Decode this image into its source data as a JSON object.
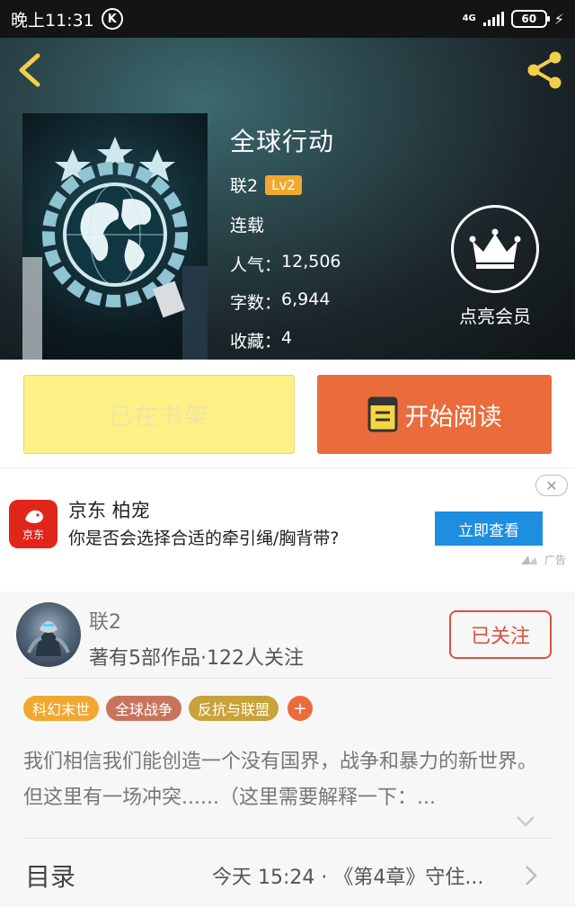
{
  "status_bar": {
    "time": "晚上11:31",
    "carrier_icon_letter": "K",
    "network": "4G",
    "battery": "60"
  },
  "book": {
    "title": "全球行动",
    "author": "联2",
    "author_level": "Lv2",
    "status": "连载",
    "popularity_label": "人气：",
    "popularity": "12,506",
    "words_label": "字数：",
    "words": "6,944",
    "favorites_label": "收藏：",
    "favorites": "4"
  },
  "vip": {
    "label": "点亮会员"
  },
  "actions": {
    "shelf_label": "已在书架",
    "read_label": "开始阅读"
  },
  "ad": {
    "brand": "京东",
    "title": "京东 柏宠",
    "description": "你是否会选择合适的牵引绳/胸背带?",
    "cta": "立即查看",
    "tag": "广告",
    "close": "✕"
  },
  "author_card": {
    "name": "联2",
    "meta": "著有5部作品·122人关注",
    "follow_label": "已关注",
    "tags": [
      {
        "label": "科幻末世",
        "color": "#f0a830"
      },
      {
        "label": "全球战争",
        "color": "#c8735c"
      },
      {
        "label": "反抗与联盟",
        "color": "#c9a23a"
      }
    ],
    "tag_add": "+",
    "intro": "我们相信我们能创造一个没有国界，战争和暴力的新世界。但这里有一场冲突......（这里需要解释一下：..."
  },
  "toc": {
    "label": "目录",
    "latest": "今天 15:24 · 《第4章》守住..."
  },
  "colors": {
    "accent_orange": "#ea6c3c",
    "shelf_yellow": "#fef084",
    "follow_red": "#d9513c",
    "ad_blue": "#1d8ee0",
    "level_badge": "#f0a830"
  }
}
